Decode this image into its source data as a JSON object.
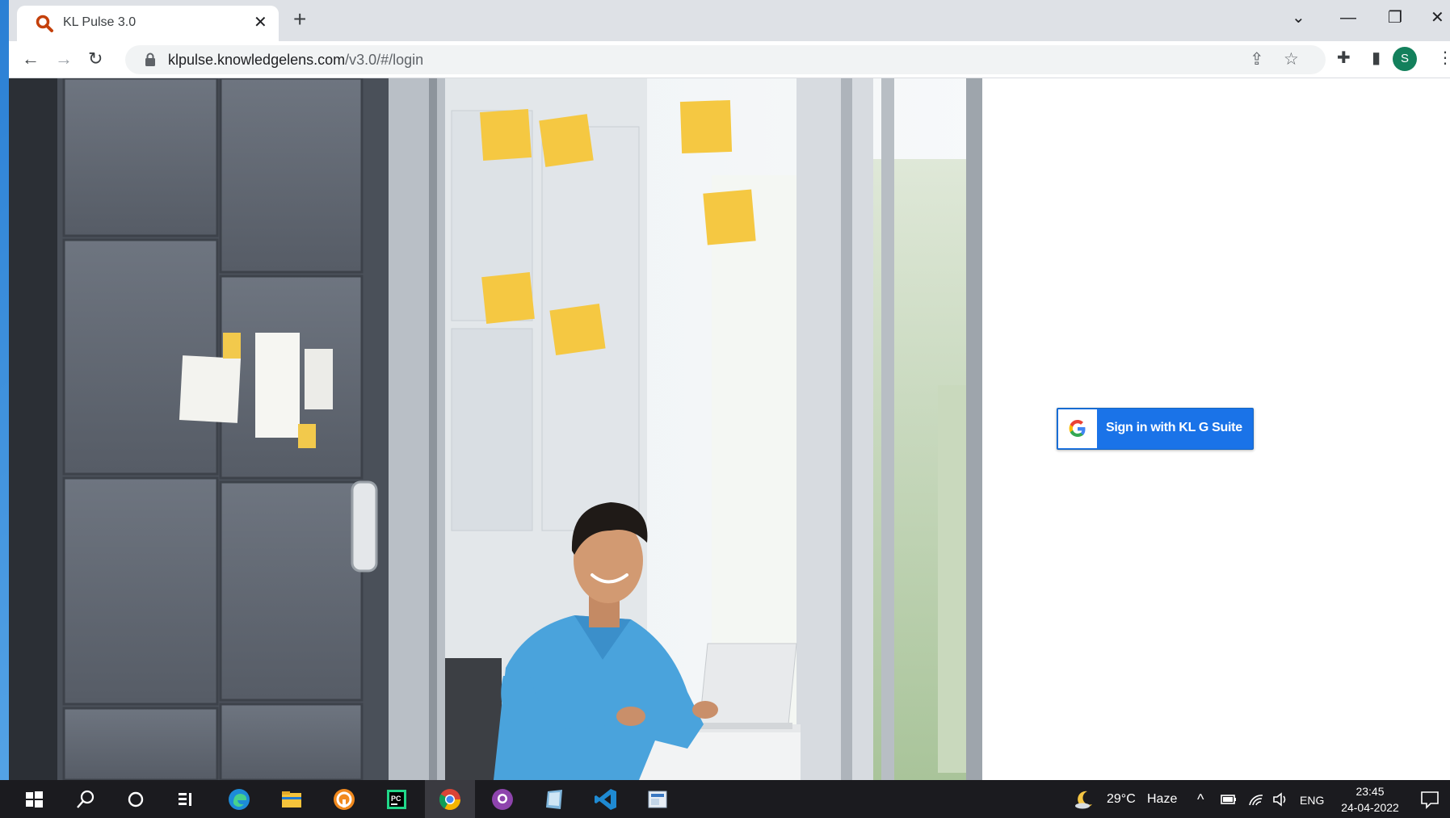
{
  "browser": {
    "tab_title": "KL Pulse 3.0",
    "tab_close": "✕",
    "new_tab": "+",
    "url_host": "klpulse.knowledgelens.com",
    "url_path": "/v3.0/#/login",
    "profile_initial": "S",
    "window_controls": {
      "dropdown": "⌄",
      "minimize": "—",
      "restore": "❐",
      "close": "✕"
    },
    "nav": {
      "back": "←",
      "forward": "→",
      "reload": "↻"
    },
    "toolbar_icons": {
      "share": "⇪",
      "star": "☆",
      "extensions": "✚",
      "sidepanel": "▮",
      "menu": "⋮"
    }
  },
  "login": {
    "signin_label": "Sign in with KL G Suite"
  },
  "taskbar": {
    "weather_temp": "29°C",
    "weather_desc": "Haze",
    "language": "ENG",
    "time": "23:45",
    "date": "24-04-2022",
    "tray_up": "^",
    "apps": [
      "windows-start",
      "search",
      "cortana",
      "task-view",
      "edge",
      "file-explorer",
      "app-orange",
      "pycharm",
      "chrome",
      "github-desktop",
      "app-notepad",
      "vscode",
      "app-image"
    ]
  },
  "colors": {
    "accent": "#1a73e8",
    "taskbar": "#1b1b1f",
    "profile": "#13805c"
  }
}
